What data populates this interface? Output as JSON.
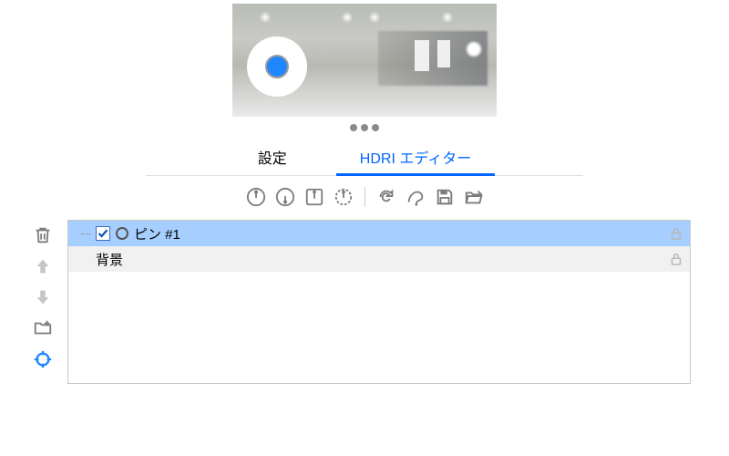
{
  "tabs": {
    "settings": "設定",
    "hdri_editor": "HDRI エディター",
    "active": "hdri_editor"
  },
  "toolbar": {
    "pin_add": "pin-add",
    "pin_remove": "pin-remove",
    "pin_ground": "pin-ground",
    "pin_rotate": "pin-rotate",
    "refresh": "refresh",
    "gradient": "gradient",
    "save": "save",
    "folder": "folder-open"
  },
  "sidebar": {
    "delete": "delete",
    "move_up": "move-up",
    "move_down": "move-down",
    "add_folder": "add-folder",
    "target": "target"
  },
  "layers": [
    {
      "name": "ピン #1",
      "selected": true,
      "checked": true,
      "has_pin_icon": true,
      "locked": true
    },
    {
      "name": "背景",
      "selected": false,
      "checked": false,
      "has_pin_icon": false,
      "locked": true
    }
  ],
  "colors": {
    "accent": "#1f87ff",
    "selection": "#a6ceff",
    "icon_gray": "#7d7d7d",
    "icon_disabled": "#c5c5c5"
  }
}
